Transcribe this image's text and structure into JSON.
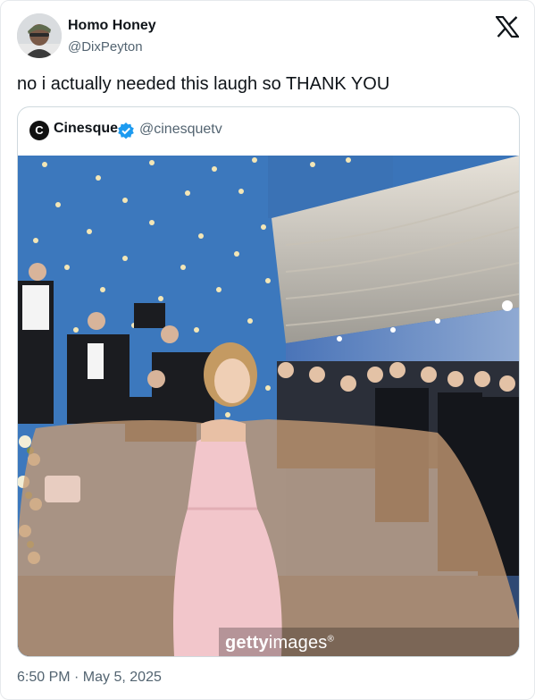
{
  "author": {
    "display_name": "Homo Honey",
    "handle": "@DixPeyton",
    "avatar_icon": "profile-photo"
  },
  "platform_icon": "x-logo-icon",
  "tweet": {
    "text": "no i actually needed this laugh so THANK YOU"
  },
  "quoted": {
    "logo_letter": "C",
    "display_name": "Cinesque",
    "verified_icon": "verified-badge-icon",
    "handle": "@cinesquetv",
    "image": {
      "watermark_bold": "getty",
      "watermark_light": "images",
      "watermark_mark": "®"
    }
  },
  "meta": {
    "timestamp": "6:50 PM · May 5, 2025"
  },
  "colors": {
    "text": "#0f1419",
    "secondary": "#536471",
    "verified": "#1d9bf0",
    "border": "#cfd9de"
  }
}
